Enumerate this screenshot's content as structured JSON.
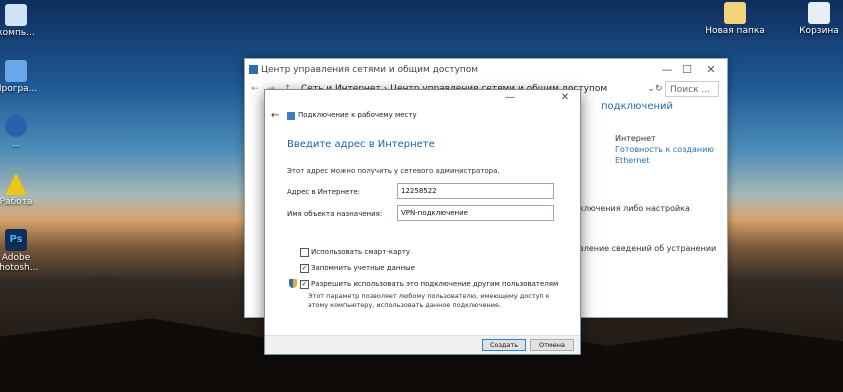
{
  "desktop": {
    "icons": [
      {
        "label": "компь...",
        "icon": "computer-icon",
        "color": "#cfe3f6"
      },
      {
        "label": "Програ...",
        "icon": "program-icon",
        "color": "#6aa7e6"
      },
      {
        "label": "...",
        "icon": "app-icon",
        "color": "#2b5fa8"
      },
      {
        "label": "Работа",
        "icon": "warning-shortcut-icon",
        "color": "#f0c419"
      },
      {
        "label": "Adobe Photosh...",
        "icon": "photoshop-icon",
        "color": "#0f2f5a"
      },
      {
        "label": "Новая папка",
        "icon": "folder-icon",
        "color": "#f4d47a"
      },
      {
        "label": "Корзина",
        "icon": "recycle-bin-icon",
        "color": "#e8eef5"
      }
    ]
  },
  "bg_window": {
    "title": "Центр управления сетями и общим доступом",
    "controls": {
      "minimize": "—",
      "maximize": "☐",
      "close": "✕"
    },
    "address": {
      "nav": "← → ↑",
      "crumb1": "Сеть и Интернет",
      "sep": "›",
      "crumb2": "Центр управления сетями и общим доступом",
      "dropdown": "⌄",
      "refresh": "↻",
      "search_placeholder": "Поиск ..."
    },
    "right": {
      "connections_heading": "подключений",
      "internet_label": "Интернет",
      "homegroup_link": "Готовность к созданию",
      "ethernet_link": "Ethernet",
      "line1": "ключения либо настройка",
      "line2": "вление сведений об устранении"
    }
  },
  "dialog": {
    "controls": {
      "minimize": "—",
      "close": "✕"
    },
    "back": "←",
    "header_title": "Подключение к рабочему месту",
    "heading": "Введите адрес в Интернете",
    "description": "Этот адрес можно получить у сетевого администратора.",
    "address_label": "Адрес в Интернете:",
    "address_value": "12258522",
    "dest_label": "Имя объекта назначения:",
    "dest_value": "VPN-подключение",
    "checkboxes": [
      {
        "label": "Использовать смарт-карту",
        "checked": false,
        "mark": ""
      },
      {
        "label": "Запомнить учетные данные",
        "checked": true,
        "mark": "✓"
      },
      {
        "label": "Разрешить использовать это подключение другим пользователям",
        "checked": true,
        "mark": "✓"
      }
    ],
    "note": "Этот параметр позволяет любому пользователю, имеющему доступ к этому компьютеру, использовать данное подключение.",
    "create_button": "Создать",
    "cancel_button": "Отмена"
  }
}
